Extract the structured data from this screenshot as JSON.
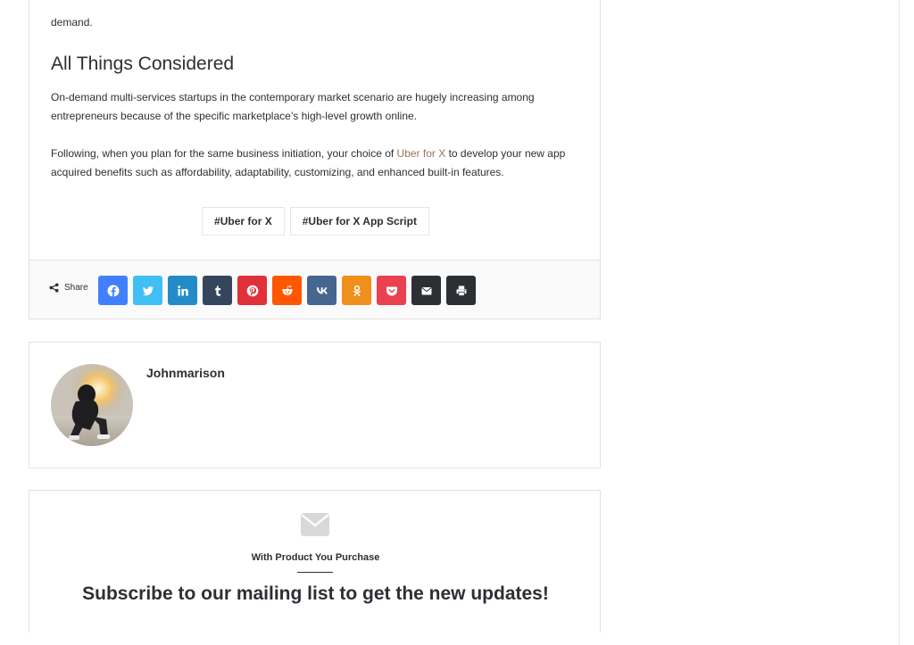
{
  "article": {
    "lead_fragment": "demand.",
    "section_heading": "All Things Considered",
    "para1": "On-demand multi-services startups in the contemporary market scenario are hugely increasing among entrepreneurs because of the specific marketplace’s high-level growth online.",
    "para2_before": "Following, when you plan for the same business initiation, your choice of ",
    "para2_link": "Uber for X",
    "para2_after": " to develop your new app acquired benefits such as affordability, adaptability, customizing, and enhanced built-in features.",
    "tags": [
      "Uber for X",
      "Uber for X App Script"
    ]
  },
  "share": {
    "label": "Share",
    "buttons": [
      {
        "name": "facebook",
        "icon": "facebook-icon",
        "color": "#4080ff"
      },
      {
        "name": "twitter",
        "icon": "twitter-icon",
        "color": "#40bff5"
      },
      {
        "name": "linkedin",
        "icon": "linkedin-icon",
        "color": "#238cc8"
      },
      {
        "name": "tumblr",
        "icon": "tumblr-icon",
        "color": "#35465c"
      },
      {
        "name": "pinterest",
        "icon": "pinterest-icon",
        "color": "#e13138"
      },
      {
        "name": "reddit",
        "icon": "reddit-icon",
        "color": "#ff5700"
      },
      {
        "name": "vk",
        "icon": "vk-icon",
        "color": "#45668e"
      },
      {
        "name": "odnoklassniki",
        "icon": "odnoklassniki-icon",
        "color": "#ef8f1c"
      },
      {
        "name": "pocket",
        "icon": "pocket-icon",
        "color": "#e9414f"
      },
      {
        "name": "email",
        "icon": "envelope-icon",
        "color": "#2c2f34"
      },
      {
        "name": "print",
        "icon": "printer-icon",
        "color": "#2c2f34"
      }
    ]
  },
  "author": {
    "name": "Johnmarison"
  },
  "newsletter": {
    "subtitle": "With Product You Purchase",
    "title": "Subscribe to our mailing list to get the new updates!"
  },
  "colors": {
    "text": "#2c2f34",
    "link": "#a0715b",
    "border": "#e2e2e2"
  }
}
